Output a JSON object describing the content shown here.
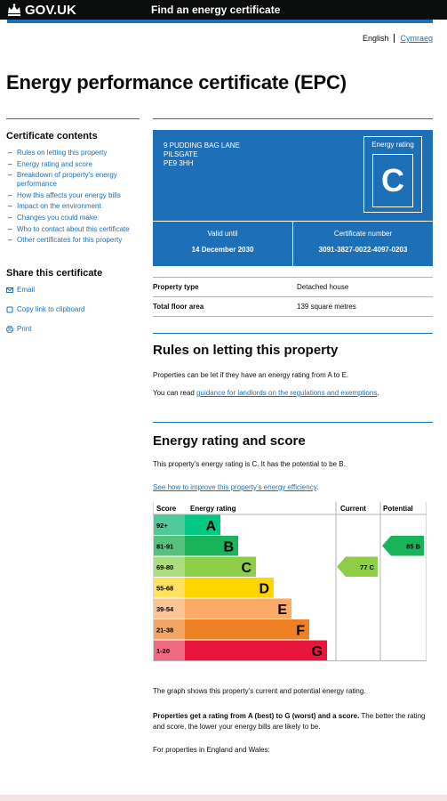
{
  "header": {
    "logo_text": "GOV.UK",
    "service_name": "Find an energy certificate"
  },
  "language": {
    "current": "English",
    "alternate": "Cymraeg"
  },
  "page_title": "Energy performance certificate (EPC)",
  "sidebar": {
    "contents_title": "Certificate contents",
    "items": [
      "Rules on letting this property",
      "Energy rating and score",
      "Breakdown of property’s energy performance",
      "How this affects your energy bills",
      "Impact on the environment",
      "Changes you could make",
      "Who to contact about this certificate",
      "Other certificates for this property"
    ],
    "share_title": "Share this certificate",
    "share": {
      "email": "Email",
      "copy": "Copy link to clipboard",
      "print": "Print"
    }
  },
  "certificate": {
    "address_line1": "9 Pudding Bag Lane",
    "address_line2": "Pilsgate",
    "postcode": "PE9 3HH",
    "rating_label": "Energy rating",
    "rating": "C",
    "valid_label": "Valid until",
    "valid_until": "14 December 2030",
    "number_label": "Certificate number",
    "number": "3091-3827-0022-4097-0203"
  },
  "summary": [
    {
      "key": "Property type",
      "value": "Detached house"
    },
    {
      "key": "Total floor area",
      "value": "139 square metres"
    }
  ],
  "rules": {
    "title": "Rules on letting this property",
    "p1": "Properties can be let if they have an energy rating from A to E.",
    "p2_prefix": "You can read ",
    "p2_link": "guidance for landlords on the regulations and exemptions",
    "p2_suffix": "."
  },
  "rating_section": {
    "title": "Energy rating and score",
    "p1": "This property’s energy rating is C. It has the potential to be B.",
    "link": "See how to improve this property’s energy efficiency",
    "link_suffix": ".",
    "graph_note": "The graph shows this property’s current and potential energy rating.",
    "bold_text": "Properties get a rating from A (best) to G (worst) and a score.",
    "rest_text": " The better the rating and score, the lower your energy bills are likely to be.",
    "england_wales": "For properties in England and Wales:"
  },
  "chart_data": {
    "type": "bar",
    "headers": {
      "score": "Score",
      "rating": "Energy rating",
      "current": "Current",
      "potential": "Potential"
    },
    "bands": [
      {
        "score": "92+",
        "letter": "A",
        "color": "#00c781",
        "score_bg": "#4fc99a"
      },
      {
        "score": "81-91",
        "letter": "B",
        "color": "#19b459",
        "score_bg": "#57c07f"
      },
      {
        "score": "69-80",
        "letter": "C",
        "color": "#8dce46",
        "score_bg": "#aedc7e"
      },
      {
        "score": "55-68",
        "letter": "D",
        "color": "#ffd500",
        "score_bg": "#ffe260"
      },
      {
        "score": "39-54",
        "letter": "E",
        "color": "#fcaa65",
        "score_bg": "#fdc493"
      },
      {
        "score": "21-38",
        "letter": "F",
        "color": "#ef8023",
        "score_bg": "#f3a566"
      },
      {
        "score": "1-20",
        "letter": "G",
        "color": "#e9153b",
        "score_bg": "#f06a82"
      }
    ],
    "current": {
      "score": 77,
      "letter": "C",
      "label": "77 C",
      "color": "#8dce46"
    },
    "potential": {
      "score": 85,
      "letter": "B",
      "label": "85 B",
      "color": "#19b459"
    }
  }
}
